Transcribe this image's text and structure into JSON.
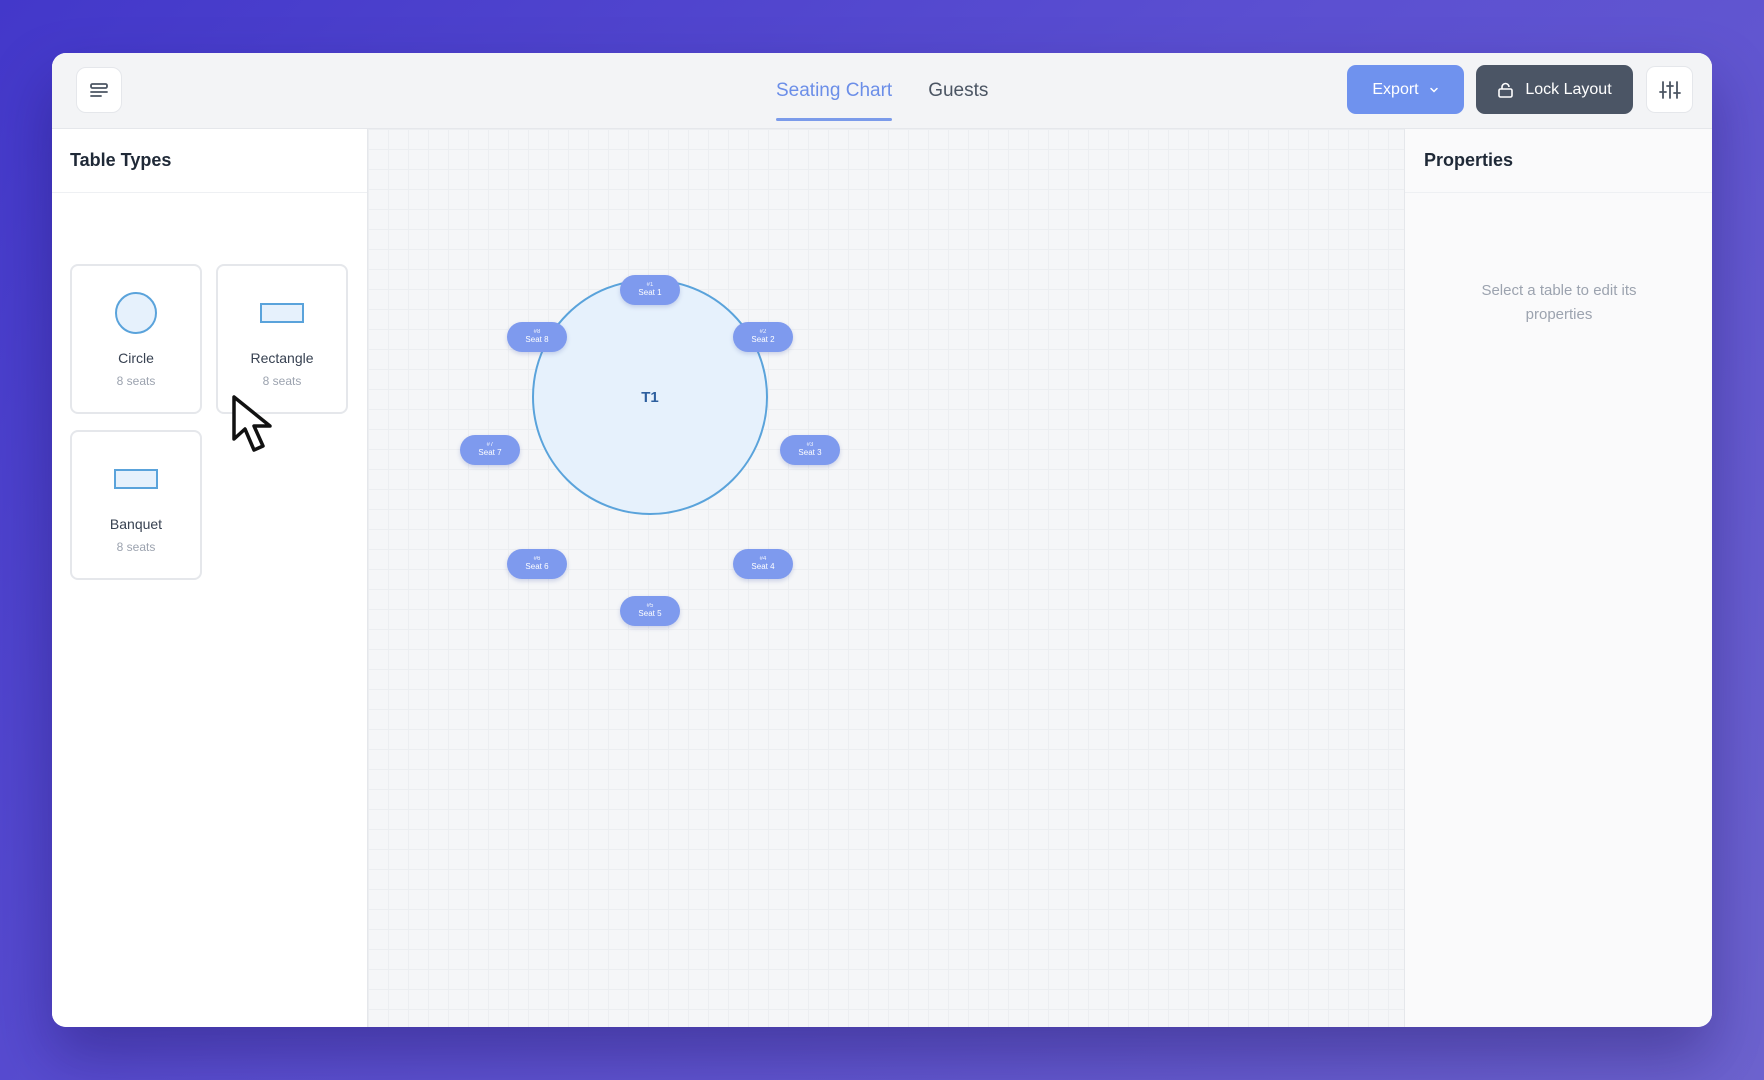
{
  "header": {
    "tabs": [
      {
        "label": "Seating Chart",
        "active": true
      },
      {
        "label": "Guests",
        "active": false
      }
    ],
    "export_label": "Export",
    "lock_label": "Lock Layout"
  },
  "left_panel": {
    "title": "Table Types",
    "types": [
      {
        "name": "Circle",
        "seats": "8 seats",
        "icon": "circle-table-icon"
      },
      {
        "name": "Rectangle",
        "seats": "8 seats",
        "icon": "rectangle-table-icon"
      },
      {
        "name": "Banquet",
        "seats": "8 seats",
        "icon": "banquet-table-icon"
      }
    ]
  },
  "canvas": {
    "table": {
      "label": "T1"
    },
    "seats": [
      {
        "num": "#1",
        "label": "Seat 1"
      },
      {
        "num": "#2",
        "label": "Seat 2"
      },
      {
        "num": "#3",
        "label": "Seat 3"
      },
      {
        "num": "#4",
        "label": "Seat 4"
      },
      {
        "num": "#5",
        "label": "Seat 5"
      },
      {
        "num": "#6",
        "label": "Seat 6"
      },
      {
        "num": "#7",
        "label": "Seat 7"
      },
      {
        "num": "#8",
        "label": "Seat 8"
      }
    ]
  },
  "right_panel": {
    "title": "Properties",
    "empty_message": "Select a table to edit its properties"
  },
  "colors": {
    "accent": "#6f92ee",
    "lock_button": "#4b5565",
    "seat": "#7e9aee",
    "table_fill": "#e6f1fc",
    "table_stroke": "#5aa3db"
  }
}
